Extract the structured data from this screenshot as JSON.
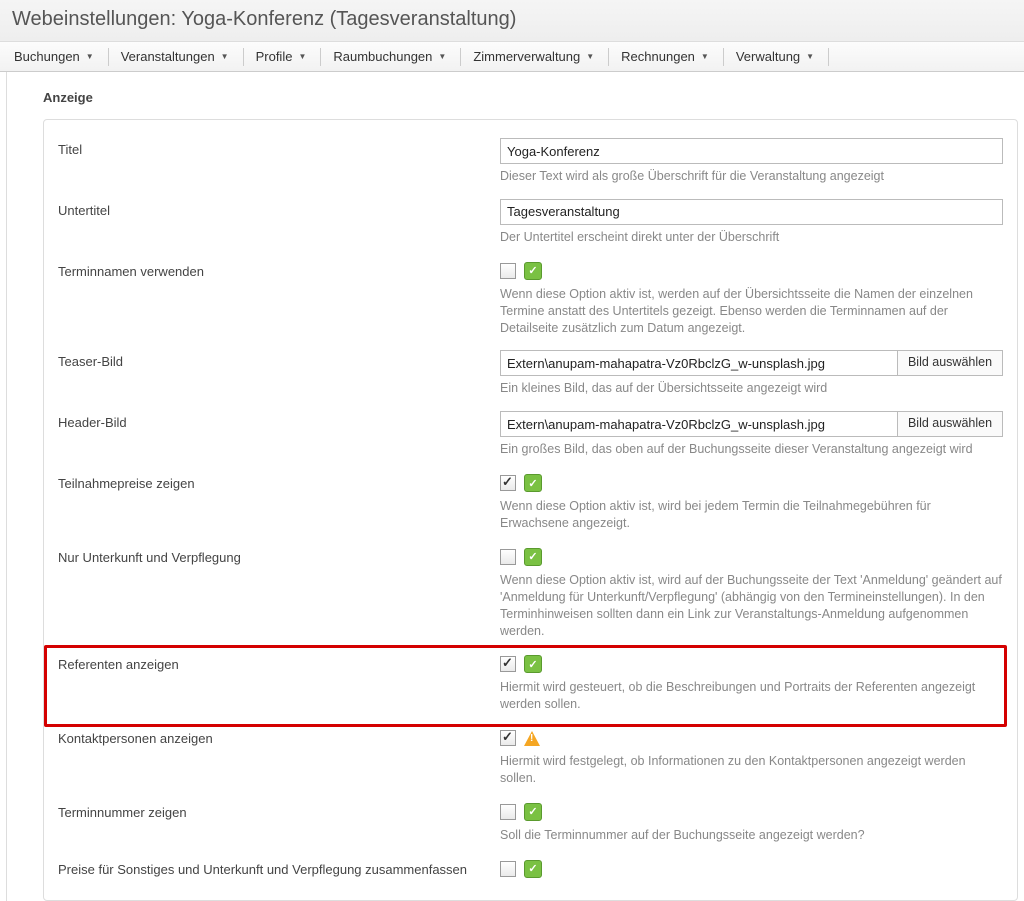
{
  "pageTitle": "Webeinstellungen: Yoga-Konferenz (Tagesveranstaltung)",
  "menu": {
    "items": [
      "Buchungen",
      "Veranstaltungen",
      "Profile",
      "Raumbuchungen",
      "Zimmerverwaltung",
      "Rechnungen",
      "Verwaltung"
    ]
  },
  "sectionHeading": "Anzeige",
  "labels": {
    "titel": "Titel",
    "untertitel": "Untertitel",
    "terminnamen": "Terminnamen verwenden",
    "teaserbild": "Teaser-Bild",
    "headerbild": "Header-Bild",
    "teilnahmepreise": "Teilnahmepreise zeigen",
    "nurUnterkunft": "Nur Unterkunft und Verpflegung",
    "referenten": "Referenten anzeigen",
    "kontaktpersonen": "Kontaktpersonen anzeigen",
    "terminnummer": "Terminnummer zeigen",
    "preiseZusammen": "Preise für Sonstiges und Unterkunft und Verpflegung zusammenfassen",
    "bildAuswaehlen": "Bild auswählen"
  },
  "values": {
    "titel": "Yoga-Konferenz",
    "untertitel": "Tagesveranstaltung",
    "teaserbild": "Extern\\anupam-mahapatra-Vz0RbclzG_w-unsplash.jpg",
    "headerbild": "Extern\\anupam-mahapatra-Vz0RbclzG_w-unsplash.jpg"
  },
  "help": {
    "titel": "Dieser Text wird als große Überschrift für die Veranstaltung angezeigt",
    "untertitel": "Der Untertitel erscheint direkt unter der Überschrift",
    "terminnamen": "Wenn diese Option aktiv ist, werden auf der Übersichtsseite die Namen der einzelnen Termine anstatt des Untertitels gezeigt. Ebenso werden die Terminnamen auf der Detailseite zusätzlich zum Datum angezeigt.",
    "teaserbild": "Ein kleines Bild, das auf der Übersichtsseite angezeigt wird",
    "headerbild": "Ein großes Bild, das oben auf der Buchungsseite dieser Veranstaltung angezeigt wird",
    "teilnahmepreise": "Wenn diese Option aktiv ist, wird bei jedem Termin die Teilnahmegebühren für Erwachsene angezeigt.",
    "nurUnterkunft": "Wenn diese Option aktiv ist, wird auf der Buchungsseite der Text 'Anmeldung' geändert auf 'Anmeldung für Unterkunft/Verpflegung' (abhängig von den Termineinstellungen). In den Terminhinweisen sollten dann ein Link zur Veranstaltungs-Anmeldung aufgenommen werden.",
    "referenten": "Hiermit wird gesteuert, ob die Beschreibungen und Portraits der Referenten angezeigt werden sollen.",
    "kontaktpersonen": "Hiermit wird festgelegt, ob Informationen zu den Kontaktpersonen angezeigt werden sollen.",
    "terminnummer": "Soll die Terminnummer auf der Buchungsseite angezeigt werden?"
  }
}
